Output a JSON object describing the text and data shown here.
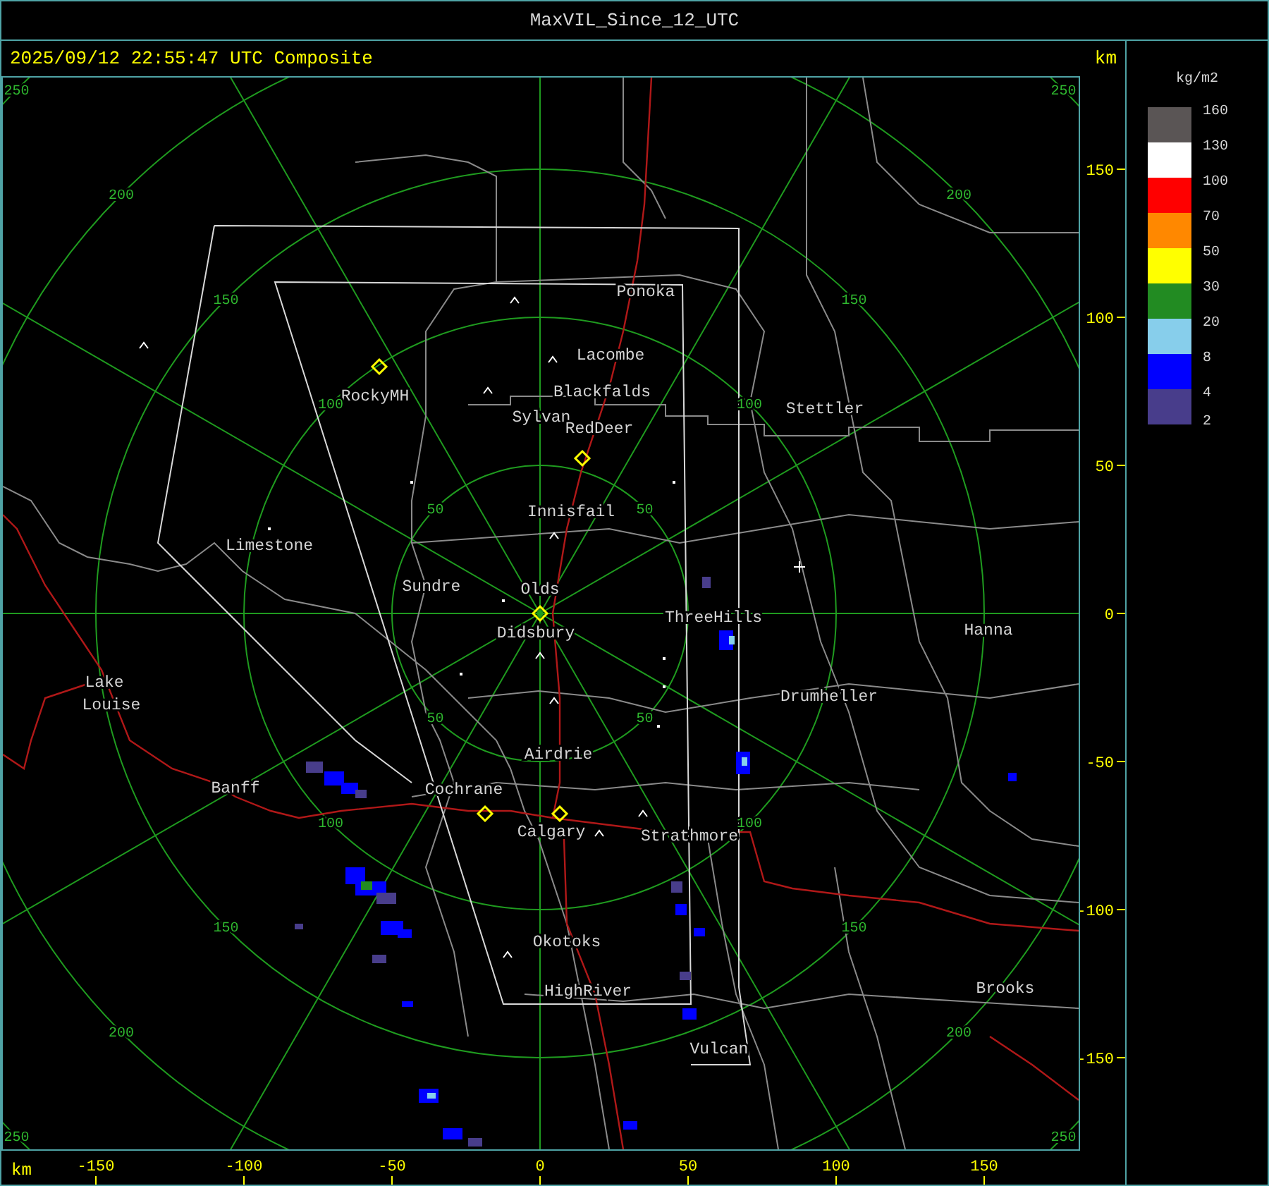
{
  "window": {
    "title": "MaxVIL_Since_12_UTC"
  },
  "header": {
    "timestamp": "2025/09/12 22:55:47 UTC Composite",
    "unit": "km"
  },
  "map": {
    "cities": [
      "Ponoka",
      "Lacombe",
      "Blackfalds",
      "Sylvan",
      "RedDeer",
      "RockyMH",
      "Innisfail",
      "Limestone",
      "Sundre",
      "Olds",
      "Didsbury",
      "ThreeHills",
      "Stettler",
      "Hanna",
      "Drumheller",
      "Lake",
      "Louise",
      "Banff",
      "Cochrane",
      "Airdrie",
      "Calgary",
      "Strathmore",
      "Okotoks",
      "HighRiver",
      "Vulcan",
      "Brooks"
    ],
    "ring_labels": [
      "250",
      "250",
      "200",
      "200",
      "150",
      "150",
      "100",
      "100",
      "50",
      "50",
      "50",
      "50",
      "100",
      "100",
      "150",
      "150",
      "200",
      "200",
      "250",
      "250"
    ]
  },
  "x_axis": {
    "unit": "km",
    "ticks": [
      "-150",
      "-100",
      "-50",
      "0",
      "50",
      "100",
      "150"
    ]
  },
  "y_axis": {
    "ticks": [
      "150",
      "100",
      "50",
      "0",
      "-50",
      "-100",
      "-150"
    ]
  },
  "legend": {
    "unit": "kg/m2",
    "bands": [
      {
        "color": "#5a5555",
        "label": "160"
      },
      {
        "color": "#ffffff",
        "label": "130"
      },
      {
        "color": "#ff0000",
        "label": "100"
      },
      {
        "color": "#ff8800",
        "label": "70"
      },
      {
        "color": "#ffff00",
        "label": "50"
      },
      {
        "color": "#228b22",
        "label": "30"
      },
      {
        "color": "#87ceeb",
        "label": "20"
      },
      {
        "color": "#0000ff",
        "label": "8"
      },
      {
        "color": "#483d8b",
        "label": "4"
      }
    ],
    "min_label": "2"
  }
}
